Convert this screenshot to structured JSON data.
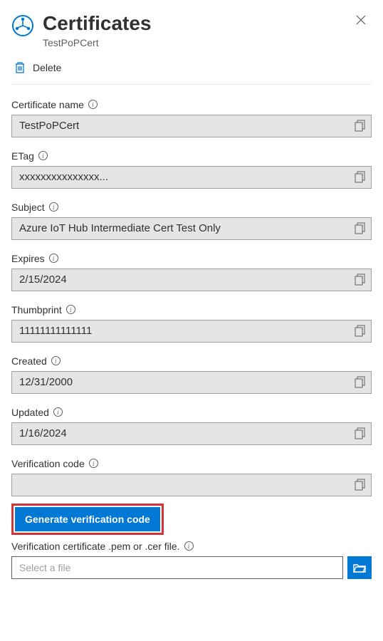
{
  "header": {
    "title": "Certificates",
    "subtitle": "TestPoPCert"
  },
  "toolbar": {
    "delete_label": "Delete"
  },
  "fields": {
    "certificate_name": {
      "label": "Certificate name",
      "value": "TestPoPCert"
    },
    "etag": {
      "label": "ETag",
      "value": "xxxxxxxxxxxxxxx..."
    },
    "subject": {
      "label": "Subject",
      "value": "Azure IoT Hub Intermediate Cert Test Only"
    },
    "expires": {
      "label": "Expires",
      "value": "2/15/2024"
    },
    "thumbprint": {
      "label": "Thumbprint",
      "value": "11111111111111"
    },
    "created": {
      "label": "Created",
      "value": "12/31/2000"
    },
    "updated": {
      "label": "Updated",
      "value": "1/16/2024"
    },
    "verification_code": {
      "label": "Verification code",
      "value": ""
    }
  },
  "actions": {
    "generate_label": "Generate verification code"
  },
  "upload": {
    "label": "Verification certificate .pem or .cer file.",
    "placeholder": "Select a file"
  }
}
